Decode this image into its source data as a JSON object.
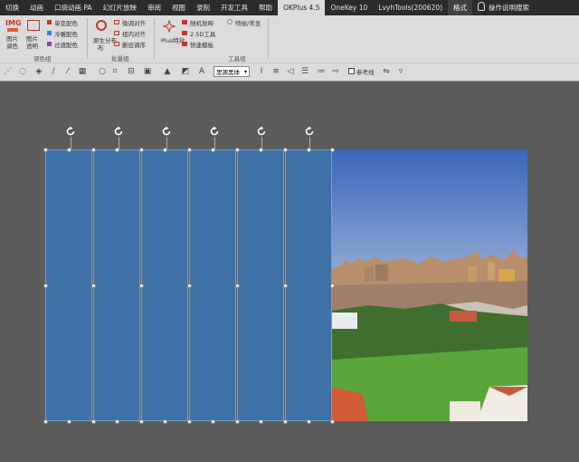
{
  "tabs": [
    {
      "label": "切换"
    },
    {
      "label": "动画"
    },
    {
      "label": "口袋动画 PA"
    },
    {
      "label": "幻灯片放映"
    },
    {
      "label": "审阅"
    },
    {
      "label": "视图"
    },
    {
      "label": "录制"
    },
    {
      "label": "开发工具"
    },
    {
      "label": "帮助"
    },
    {
      "label": "OKPlus 4.5"
    },
    {
      "label": "OneKey 10"
    },
    {
      "label": "LvyhTools(200620)"
    },
    {
      "label": "格式"
    },
    {
      "label": "操作说明搜索"
    }
  ],
  "ribbon": {
    "img_logo": "IMG",
    "img_color": "图片\n调色",
    "img_transparent": "图片\n透明",
    "single_color": "单变配色",
    "cold_color": "冷暖配色",
    "gradient_color": "过渡配色",
    "group_color": "调色组",
    "origin_distribute": "原生分布",
    "origin_distribute_sub": "布",
    "fine_align": "微调对齐",
    "group_align": "组内对齐",
    "delete_swap": "删层调序",
    "group_batch": "批量组",
    "plus_special": "Plus特效",
    "random_order": "随机放映",
    "tools_25d": "2.5D工具",
    "quick_template": "快速模板",
    "spray_usual": "喷绘/常显",
    "group_tools": "工具组"
  },
  "toolbar": {
    "font_value": "思源黑体",
    "ref_line_label": "参考线"
  },
  "colors": {
    "tab_bg": "#2b2b2b",
    "ribbon_bg": "#dcdcdc",
    "canvas_bg": "#5b5b5b",
    "strip_fill": "#3e71a6",
    "accent_red": "#c0392b"
  }
}
